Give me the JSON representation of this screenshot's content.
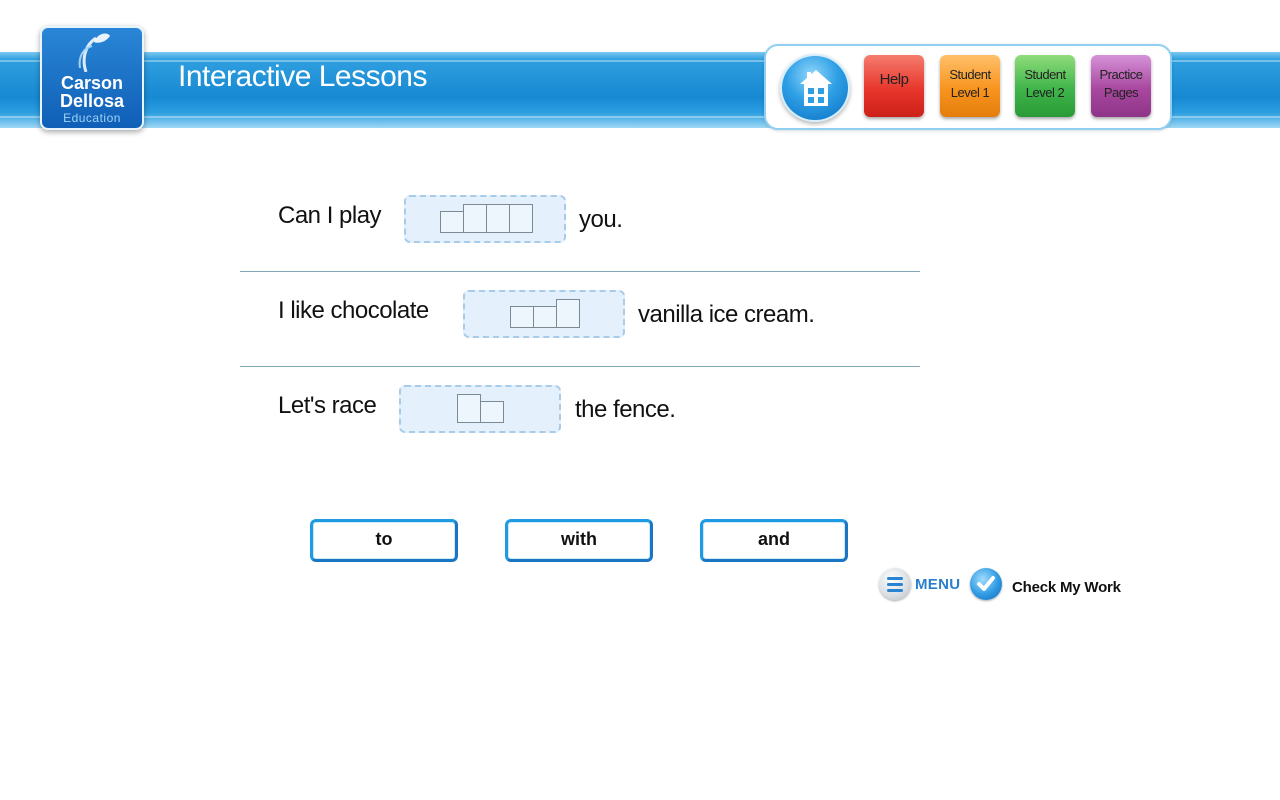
{
  "logo": {
    "line1": "Carson",
    "line2": "Dellosa",
    "line3": "Education"
  },
  "header": {
    "title": "Interactive Lessons"
  },
  "nav": {
    "home_icon": "house-icon",
    "help": "Help",
    "student_level_1": "Student\nLevel 1",
    "student_level_2": "Student\nLevel 2",
    "practice_pages": "Practice\nPages"
  },
  "sentences": [
    {
      "before": "Can I play",
      "after": "you."
    },
    {
      "before": "I like chocolate",
      "after": "vanilla ice cream."
    },
    {
      "before": "Let's race",
      "after": "the fence."
    }
  ],
  "word_bank": [
    "to",
    "with",
    "and"
  ],
  "controls": {
    "menu_label": "MENU",
    "menu_icon": "menu-icon",
    "check_label": "Check My Work",
    "check_icon": "checkmark-icon"
  },
  "colors": {
    "header_blue": "#1e8fd6",
    "help_red": "#e8362c",
    "level1_orange": "#f7941e",
    "level2_green": "#3fb54a",
    "practice_purple": "#a8479f",
    "word_border": "#1e9be3"
  }
}
